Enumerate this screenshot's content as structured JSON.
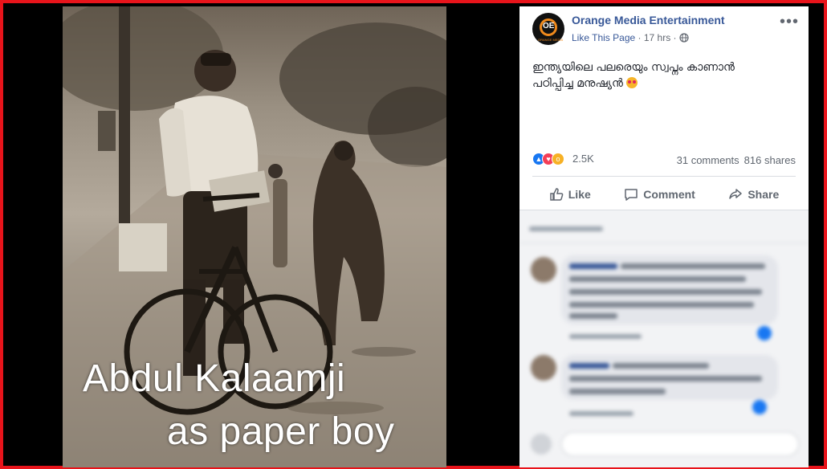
{
  "post": {
    "page_name": "Orange Media Entertainment",
    "like_page_link": "Like This Page",
    "time": "17 hrs",
    "separator": " · ",
    "text_line1": "ഇന്ത്യയിലെ പലരെയും സ്വപ്നം കാണാൻ",
    "text_line2": "പഠിപ്പിച്ച മനുഷ്യൻ",
    "reaction_count": "2.5K",
    "comments_count": "31 comments",
    "shares_count": "816 shares",
    "logo_letters": "OE",
    "logo_small": "ORANGE MEDIA"
  },
  "actions": {
    "like": "Like",
    "comment": "Comment",
    "share": "Share"
  },
  "image": {
    "caption_line1": "Abdul Kalaamji",
    "caption_line2": "as paper boy"
  },
  "icons": {
    "menu": "more-dots-icon",
    "privacy": "globe-icon",
    "like_action": "thumbs-up-icon",
    "comment_action": "comment-bubble-icon",
    "share_action": "share-arrow-icon"
  },
  "colors": {
    "frame": "#e8141b",
    "link": "#385898",
    "like_blue": "#1877f2",
    "love_red": "#f33e58",
    "wow_yellow": "#f7b125"
  }
}
